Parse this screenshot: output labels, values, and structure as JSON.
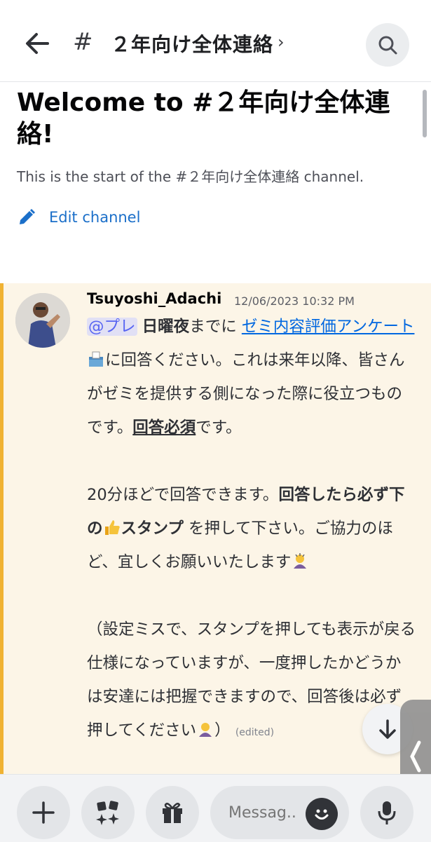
{
  "header": {
    "hash": "#",
    "title": "２年向け全体連絡",
    "chevron": "›"
  },
  "welcome": {
    "title": "Welcome to #２年向け全体連絡!",
    "subtitle": "This is the start of the #２年向け全体連絡 channel.",
    "edit_label": "Edit channel"
  },
  "message": {
    "author": "Tsuyoshi_Adachi",
    "timestamp": "12/06/2023 10:32 PM",
    "mention": "@プレ",
    "p1_bold": "日曜夜",
    "p1_a": "までに ",
    "p1_link": "ゼミ内容評価アンケート",
    "p1_b": "に回答ください。これは来年以降、皆さんがゼミを提供する側になった際に役立つものです。",
    "p1_required": "回答必須",
    "p1_c": "です。",
    "p2_a": "20分ほどで回答できます。",
    "p2_bold_a": "回答したら必ず下の",
    "p2_bold_b": "スタンプ",
    "p2_b": " を押して下さい。ご協力のほど、宜しくお願いいたします",
    "p3": "（設定ミスで、スタンプを押しても表示が戻る仕様になっていますが、一度押したかどうかは安達には把握できますので、回答後は必ず押してください",
    "p3_end": "）",
    "edited": "(edited)"
  },
  "composer": {
    "placeholder": "Messag.."
  },
  "icons": {
    "back": "arrow-left-icon",
    "search": "search-icon",
    "edit": "pencil-icon",
    "jump": "arrow-down-icon",
    "add": "plus-icon",
    "apps": "apps-sparkle-icon",
    "gift": "gift-icon",
    "emoji": "smile-icon",
    "mic": "microphone-icon"
  },
  "colors": {
    "accent_link": "#0067e0",
    "mention_bar": "#f0b232",
    "mention_bg": "#fcf5e7"
  }
}
